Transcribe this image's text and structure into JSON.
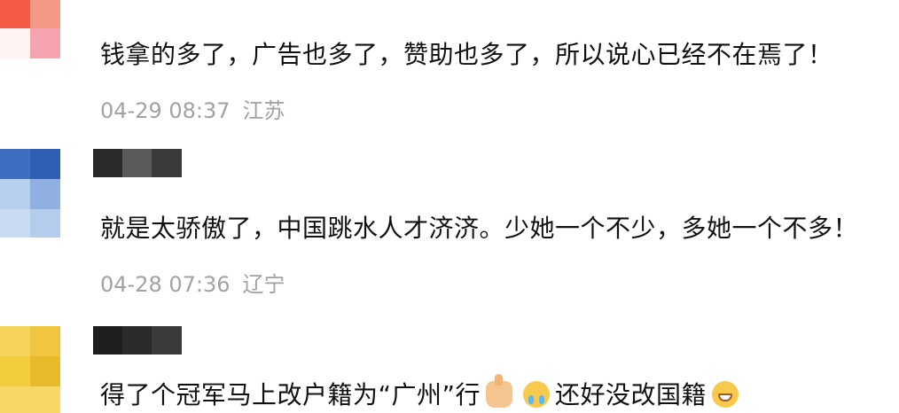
{
  "comments": [
    {
      "text": "钱拿的多了，广告也多了，赞助也多了，所以说心已经不在焉了！",
      "date": "04-29 08:37",
      "location": "江苏",
      "avatar_colors": [
        "#f45b45",
        "#f29a86",
        "#ffffff",
        "#f5a3ae"
      ],
      "username_blur_colors": []
    },
    {
      "text": "就是太骄傲了，中国跳水人才济济。少她一个不少，多她一个不多！",
      "date": "04-28 07:36",
      "location": "辽宁",
      "avatar_colors": [
        "#3d6fc0",
        "#2f5fb5",
        "#b8d0ee",
        "#8fb0e0",
        "#c9dbf2",
        "#b4cdec"
      ],
      "username_blur_colors": [
        "#2a2a2a",
        "#5a5a5a",
        "#3a3a3a"
      ]
    },
    {
      "text_part1": "得了个冠军马上改户籍为“广州”行",
      "text_part2": "还好没改国籍",
      "emojis": [
        "thumbs-up",
        "crying-face",
        "grinning-face"
      ],
      "avatar_colors": [
        "#f6d45c",
        "#f0c640",
        "#f2cd3e",
        "#e6ba2a",
        "#f7d866"
      ],
      "username_blur_colors": [
        "#1e1e1e",
        "#2b2b2b",
        "#3a3a3a"
      ]
    }
  ]
}
